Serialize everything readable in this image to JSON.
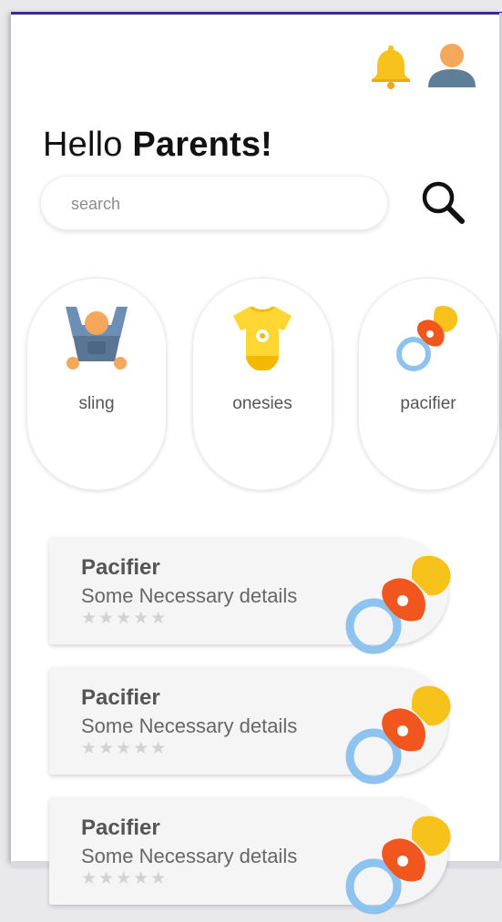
{
  "header": {
    "greeting_prefix": "Hello",
    "greeting_name": "Parents!",
    "notification_icon": "bell-icon",
    "profile_icon": "user-avatar-icon"
  },
  "search": {
    "placeholder": "search",
    "value": "",
    "icon": "search-icon"
  },
  "categories": [
    {
      "label": "sling",
      "icon": "baby-carrier-icon"
    },
    {
      "label": "onesies",
      "icon": "onesie-icon"
    },
    {
      "label": "pacifier",
      "icon": "pacifier-icon"
    }
  ],
  "products": [
    {
      "title": "Pacifier",
      "details": "Some Necessary details",
      "stars": "★★★★★",
      "icon": "pacifier-icon"
    },
    {
      "title": "Pacifier",
      "details": "Some Necessary details",
      "stars": "★★★★★",
      "icon": "pacifier-icon"
    },
    {
      "title": "Pacifier",
      "details": "Some Necessary details",
      "stars": "★★★★★",
      "icon": "pacifier-icon"
    }
  ],
  "colors": {
    "accent_bar": "#3b2a8a",
    "bell": "#f7c21c",
    "avatar_head": "#f5a85b",
    "avatar_body": "#5f7f98",
    "card_bg": "#f5f5f5",
    "stars": "#d2d2d2"
  }
}
